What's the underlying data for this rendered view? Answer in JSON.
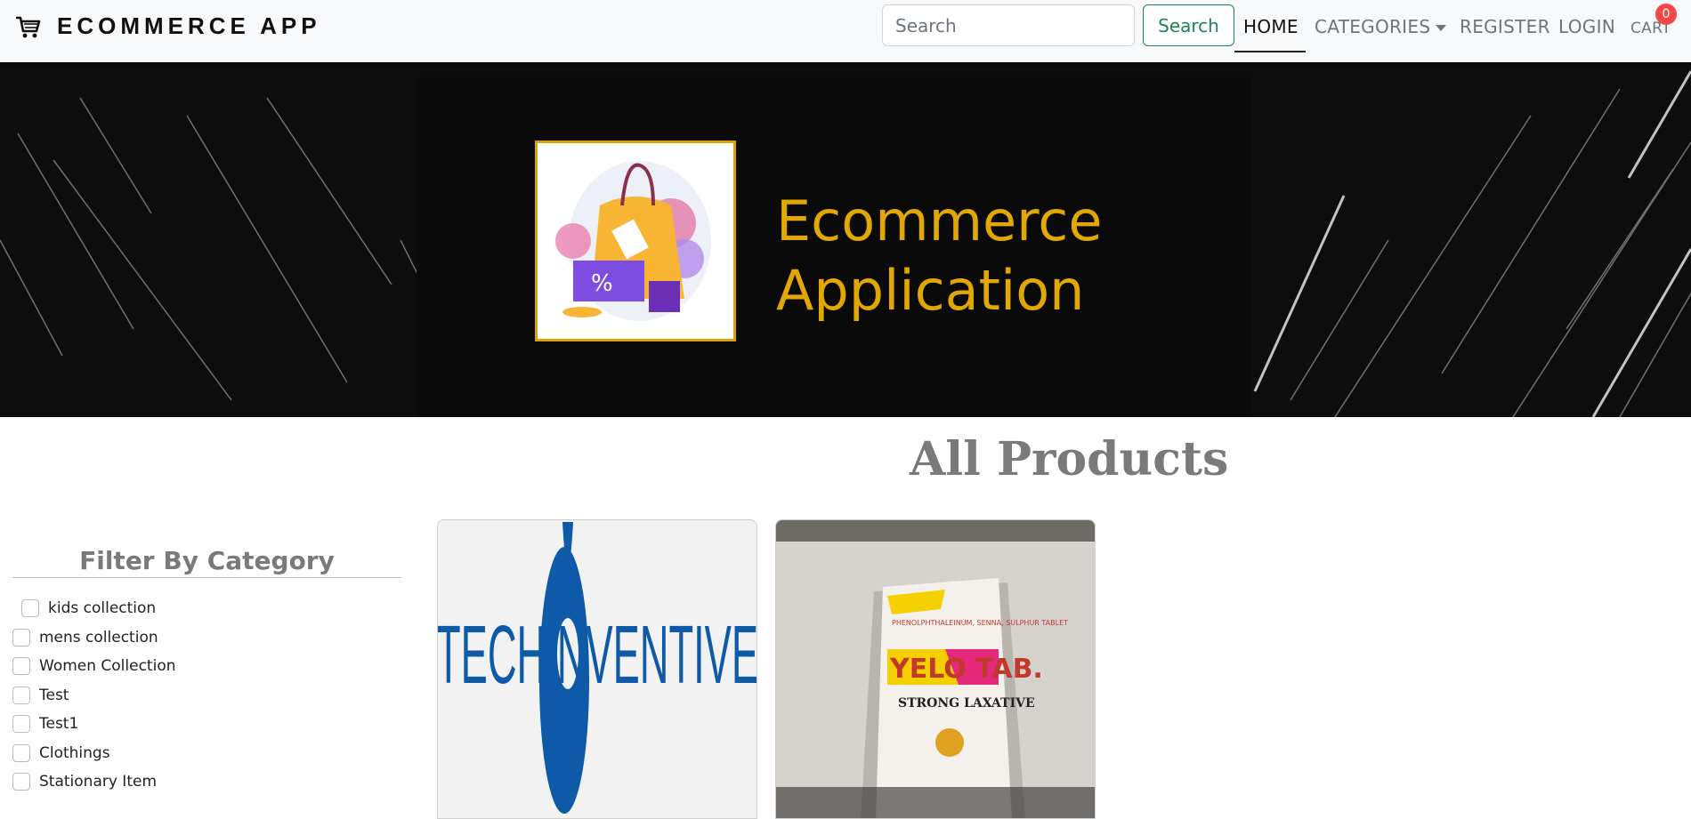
{
  "navbar": {
    "brand": "ECOMMERCE APP",
    "brand_icon": "shopping-cart-icon",
    "search_placeholder": "Search",
    "search_button": "Search",
    "links": {
      "home": "HOME",
      "categories": "CATEGORIES",
      "register": "REGISTER",
      "login": "LOGIN",
      "cart": "CART"
    },
    "cart_count": "0"
  },
  "banner": {
    "title_line1": "Ecommerce",
    "title_line2": "Application"
  },
  "main": {
    "title": "All Products",
    "filter": {
      "title": "Filter By Category",
      "categories": [
        "kids collection",
        "mens collection",
        "Women Collection",
        "Test",
        "Test1",
        "Clothings",
        "Stationary Item"
      ]
    },
    "products": [
      {
        "image_text": "TECHINVENTIVE"
      },
      {
        "image_text_1": "PHENOLPHTHALEINUM, SENNA, SULPHUR TABLET",
        "image_text_2": "YELO TAB.",
        "image_text_3": "STRONG LAXATIVE"
      }
    ]
  },
  "colors": {
    "accent_green": "#198754",
    "badge_red": "#f24848",
    "banner_gold": "#e0a800"
  }
}
